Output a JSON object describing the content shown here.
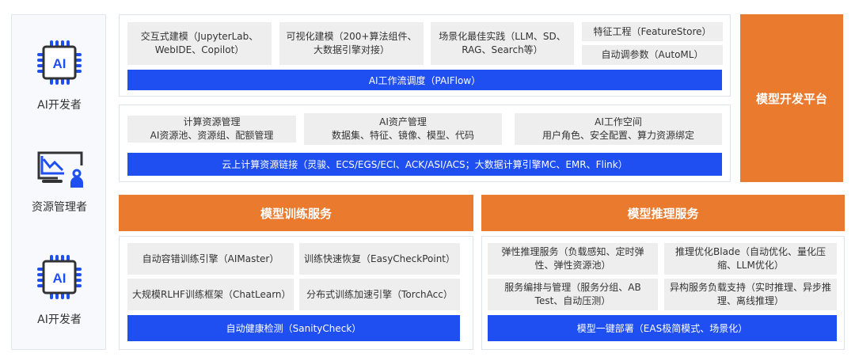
{
  "roles": [
    "AI开发者",
    "资源管理者",
    "AI开发者"
  ],
  "platform": {
    "title": "模型开发平台",
    "dev_tools": [
      "交互式建模（JupyterLab、WebIDE、Copilot）",
      "可视化建模（200+算法组件、大数据引擎对接）",
      "场景化最佳实践（LLM、SD、RAG、Search等）",
      "特征工程（FeatureStore）",
      "自动调参数（AutoML）"
    ],
    "workflow": "AI工作流调度（PAIFlow）",
    "resources": [
      {
        "title": "计算资源管理",
        "desc": "AI资源池、资源组、配额管理"
      },
      {
        "title": "AI资产管理",
        "desc": "数据集、特征、镜像、模型、代码"
      },
      {
        "title": "AI工作空间",
        "desc": "用户角色、安全配置、算力资源绑定"
      }
    ],
    "compute": "云上计算资源链接（灵骏、ECS/EGS/ECI、ACK/ASI/ACS；大数据计算引擎MC、EMR、Flink）"
  },
  "training": {
    "title": "模型训练服务",
    "items": [
      "自动容错训练引擎（AIMaster）",
      "训练快速恢复（EasyCheckPoint）",
      "大规模RLHF训练框架（ChatLearn）",
      "分布式训练加速引擎（TorchAcc）"
    ],
    "bar": "自动健康检测（SanityCheck）"
  },
  "inference": {
    "title": "模型推理服务",
    "items": [
      "弹性推理服务（负载感知、定时弹性、弹性资源池）",
      "推理优化Blade（自动优化、量化压缩、LLM优化）",
      "服务编排与管理（服务分组、AB Test、自动压测）",
      "异构服务负载支持（实时推理、异步推理、离线推理）"
    ],
    "bar": "模型一键部署（EAS极简模式、场景化）"
  }
}
